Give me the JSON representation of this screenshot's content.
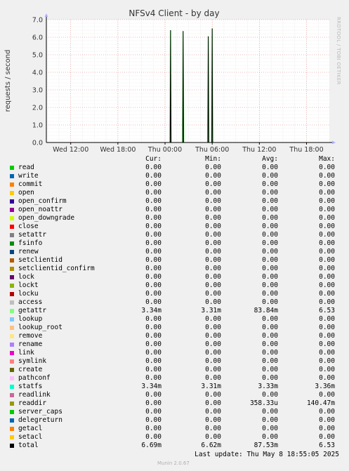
{
  "chart_data": {
    "type": "line",
    "title": "NFSv4 Client - by day",
    "ylabel": "requests / second",
    "xlabel": "",
    "ylim": [
      0,
      7
    ],
    "yticks": [
      "0.0",
      "1.0",
      "2.0",
      "3.0",
      "4.0",
      "5.0",
      "6.0",
      "7.0"
    ],
    "xticks": [
      "Wed 12:00",
      "Wed 18:00",
      "Thu 00:00",
      "Thu 06:00",
      "Thu 12:00",
      "Thu 18:00"
    ],
    "x_start_hours": 8.9,
    "x_end_hours": 44.9,
    "spikes": [
      {
        "time_hours": 24.7,
        "value": 6.4
      },
      {
        "time_hours": 26.3,
        "value": 6.35
      },
      {
        "time_hours": 29.5,
        "value": 6.05
      },
      {
        "time_hours": 30.0,
        "value": 6.5
      }
    ],
    "grid": true
  },
  "side_note": "RRDTOOL / TOBI OETIKER",
  "headers": {
    "cur": "Cur:",
    "min": "Min:",
    "avg": "Avg:",
    "max": "Max:"
  },
  "legend": [
    {
      "name": "read",
      "color": "#00cc00",
      "cur": "0.00",
      "min": "0.00",
      "avg": "0.00",
      "max": "0.00"
    },
    {
      "name": "write",
      "color": "#0066b3",
      "cur": "0.00",
      "min": "0.00",
      "avg": "0.00",
      "max": "0.00"
    },
    {
      "name": "commit",
      "color": "#ff8000",
      "cur": "0.00",
      "min": "0.00",
      "avg": "0.00",
      "max": "0.00"
    },
    {
      "name": "open",
      "color": "#ffcc00",
      "cur": "0.00",
      "min": "0.00",
      "avg": "0.00",
      "max": "0.00"
    },
    {
      "name": "open_confirm",
      "color": "#330099",
      "cur": "0.00",
      "min": "0.00",
      "avg": "0.00",
      "max": "0.00"
    },
    {
      "name": "open_noattr",
      "color": "#990099",
      "cur": "0.00",
      "min": "0.00",
      "avg": "0.00",
      "max": "0.00"
    },
    {
      "name": "open_downgrade",
      "color": "#ccff00",
      "cur": "0.00",
      "min": "0.00",
      "avg": "0.00",
      "max": "0.00"
    },
    {
      "name": "close",
      "color": "#ff0000",
      "cur": "0.00",
      "min": "0.00",
      "avg": "0.00",
      "max": "0.00"
    },
    {
      "name": "setattr",
      "color": "#808080",
      "cur": "0.00",
      "min": "0.00",
      "avg": "0.00",
      "max": "0.00"
    },
    {
      "name": "fsinfo",
      "color": "#008f00",
      "cur": "0.00",
      "min": "0.00",
      "avg": "0.00",
      "max": "0.00"
    },
    {
      "name": "renew",
      "color": "#00487d",
      "cur": "0.00",
      "min": "0.00",
      "avg": "0.00",
      "max": "0.00"
    },
    {
      "name": "setclientid",
      "color": "#b35a00",
      "cur": "0.00",
      "min": "0.00",
      "avg": "0.00",
      "max": "0.00"
    },
    {
      "name": "setclientid_confirm",
      "color": "#b38f00",
      "cur": "0.00",
      "min": "0.00",
      "avg": "0.00",
      "max": "0.00"
    },
    {
      "name": "lock",
      "color": "#6b006b",
      "cur": "0.00",
      "min": "0.00",
      "avg": "0.00",
      "max": "0.00"
    },
    {
      "name": "lockt",
      "color": "#8fb300",
      "cur": "0.00",
      "min": "0.00",
      "avg": "0.00",
      "max": "0.00"
    },
    {
      "name": "locku",
      "color": "#b30000",
      "cur": "0.00",
      "min": "0.00",
      "avg": "0.00",
      "max": "0.00"
    },
    {
      "name": "access",
      "color": "#bebebe",
      "cur": "0.00",
      "min": "0.00",
      "avg": "0.00",
      "max": "0.00"
    },
    {
      "name": "getattr",
      "color": "#80ff80",
      "cur": "3.34m",
      "min": "3.31m",
      "avg": "83.84m",
      "max": "6.53"
    },
    {
      "name": "lookup",
      "color": "#80c9ff",
      "cur": "0.00",
      "min": "0.00",
      "avg": "0.00",
      "max": "0.00"
    },
    {
      "name": "lookup_root",
      "color": "#ffc080",
      "cur": "0.00",
      "min": "0.00",
      "avg": "0.00",
      "max": "0.00"
    },
    {
      "name": "remove",
      "color": "#ffe680",
      "cur": "0.00",
      "min": "0.00",
      "avg": "0.00",
      "max": "0.00"
    },
    {
      "name": "rename",
      "color": "#aa80ff",
      "cur": "0.00",
      "min": "0.00",
      "avg": "0.00",
      "max": "0.00"
    },
    {
      "name": "link",
      "color": "#ee00cc",
      "cur": "0.00",
      "min": "0.00",
      "avg": "0.00",
      "max": "0.00"
    },
    {
      "name": "symlink",
      "color": "#ff8080",
      "cur": "0.00",
      "min": "0.00",
      "avg": "0.00",
      "max": "0.00"
    },
    {
      "name": "create",
      "color": "#666600",
      "cur": "0.00",
      "min": "0.00",
      "avg": "0.00",
      "max": "0.00"
    },
    {
      "name": "pathconf",
      "color": "#ffbfff",
      "cur": "0.00",
      "min": "0.00",
      "avg": "0.00",
      "max": "0.00"
    },
    {
      "name": "statfs",
      "color": "#00ffcc",
      "cur": "3.34m",
      "min": "3.31m",
      "avg": "3.33m",
      "max": "3.36m"
    },
    {
      "name": "readlink",
      "color": "#cc6699",
      "cur": "0.00",
      "min": "0.00",
      "avg": "0.00",
      "max": "0.00"
    },
    {
      "name": "readdir",
      "color": "#999900",
      "cur": "0.00",
      "min": "0.00",
      "avg": "358.33u",
      "max": "140.47m"
    },
    {
      "name": "server_caps",
      "color": "#00cc00",
      "cur": "0.00",
      "min": "0.00",
      "avg": "0.00",
      "max": "0.00"
    },
    {
      "name": "delegreturn",
      "color": "#0066b3",
      "cur": "0.00",
      "min": "0.00",
      "avg": "0.00",
      "max": "0.00"
    },
    {
      "name": "getacl",
      "color": "#ff8000",
      "cur": "0.00",
      "min": "0.00",
      "avg": "0.00",
      "max": "0.00"
    },
    {
      "name": "setacl",
      "color": "#ffcc00",
      "cur": "0.00",
      "min": "0.00",
      "avg": "0.00",
      "max": "0.00"
    },
    {
      "name": "total",
      "color": "#000000",
      "cur": "6.69m",
      "min": "6.62m",
      "avg": "87.53m",
      "max": "6.53"
    }
  ],
  "footer": {
    "last_update": "Last update: Thu May  8 18:55:05 2025",
    "version": "Munin 2.0.67"
  }
}
